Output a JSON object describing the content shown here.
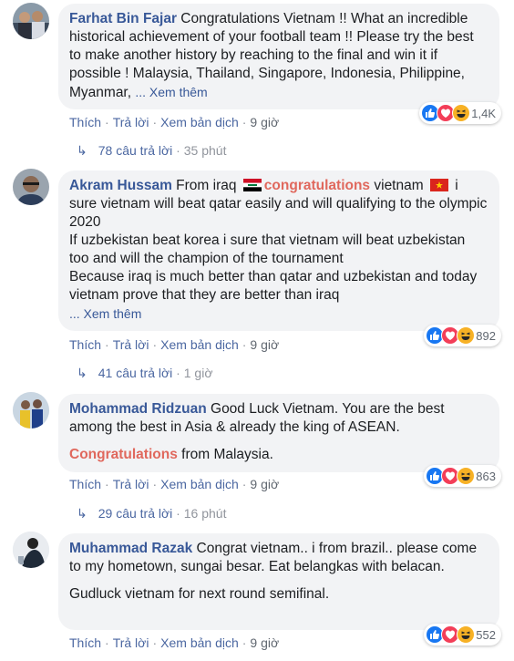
{
  "actions": {
    "like": "Thích",
    "reply": "Trả lời",
    "translate": "Xem bản dịch",
    "sep": "·"
  },
  "reaction_types": [
    "like",
    "love",
    "haha"
  ],
  "comments": [
    {
      "author": "Farhat Bin Fajar",
      "text_1": " Congratulations Vietnam !! What an incredible historical achievement of your football team !! Please try the best to make another history by reaching to the final and win it if possible ! Malaysia, Thailand, Singapore, Indonesia, Philippine, Myanmar, ",
      "see_more": "... Xem thêm",
      "time": "9 giờ",
      "reaction_count": "1,4K",
      "replies": "78 câu trả lời",
      "replies_time": "35 phút"
    },
    {
      "author": "Akram Hussam",
      "text_1": " From iraq ",
      "highlight": "congratulations",
      "text_2": " vietnam ",
      "text_3": " i sure vietnam will beat qatar easily and will qualifying to the olympic 2020",
      "text_4": "If uzbekistan beat korea i sure that vietnam will beat uzbekistan too and will the champion of the tournament",
      "text_5": "Because iraq is much better than qatar and uzbekistan and today vietnam prove that they are better than iraq",
      "see_more": "... Xem thêm",
      "time": "9 giờ",
      "reaction_count": "892",
      "replies": "41 câu trả lời",
      "replies_time": "1 giờ"
    },
    {
      "author": "Mohammad Ridzuan",
      "text_1": " Good Luck Vietnam. You are the best among the best in Asia & already the king of ASEAN.",
      "highlight": "Congratulations",
      "text_2": " from Malaysia.",
      "time": "9 giờ",
      "reaction_count": "863",
      "replies": "29 câu trả lời",
      "replies_time": "16 phút"
    },
    {
      "author": "Muhammad Razak",
      "text_1": " Congrat vietnam.. i from brazil.. please come to my hometown, sungai besar. Eat belangkas with belacan.",
      "text_2": "Gudluck vietnam for next round semifinal.",
      "time": "9 giờ",
      "reaction_count": "552"
    }
  ]
}
